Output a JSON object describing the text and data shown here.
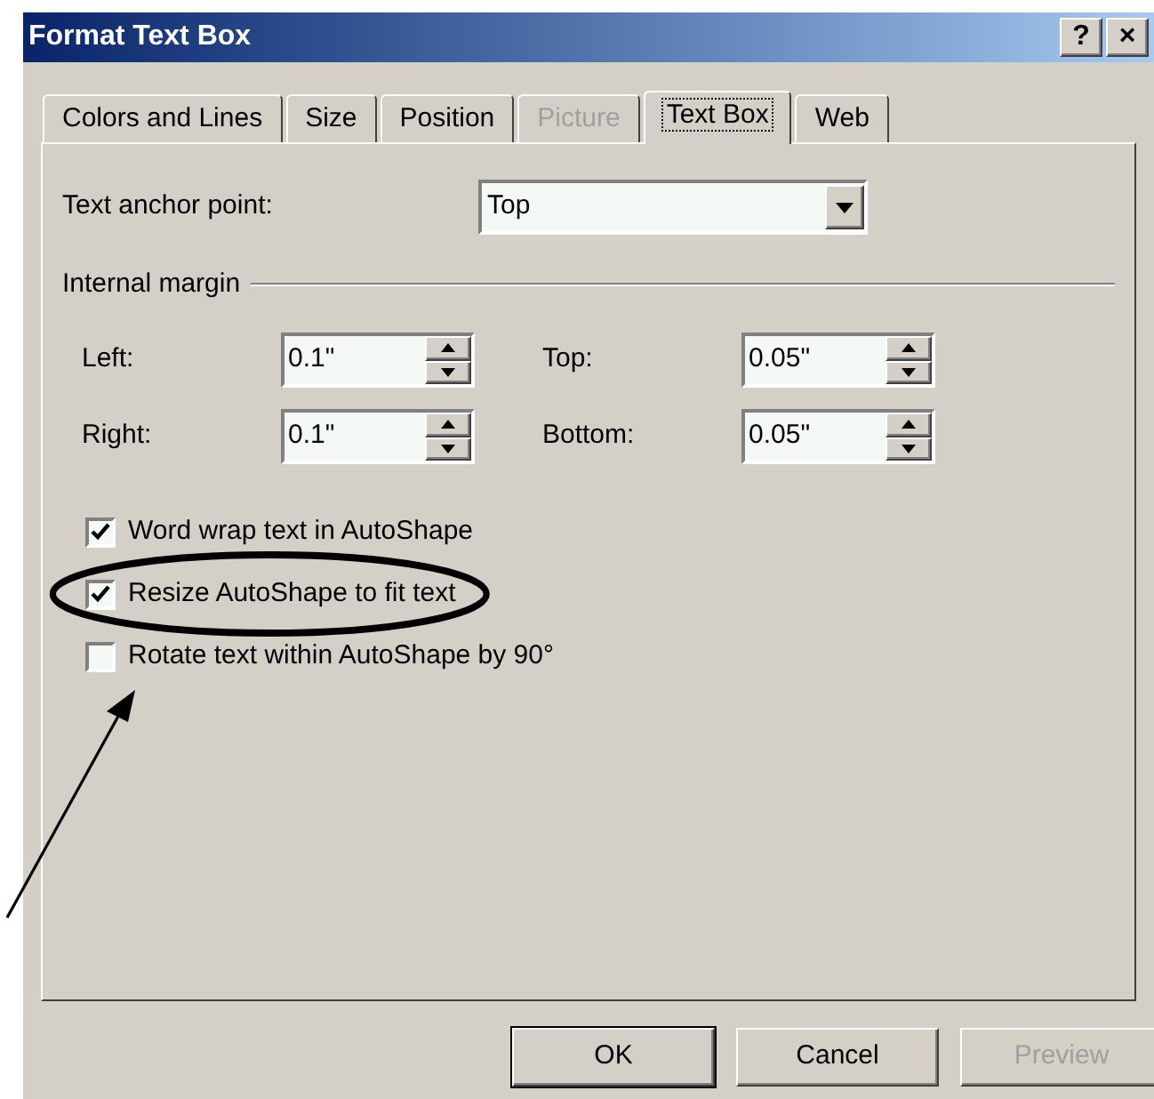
{
  "window": {
    "title": "Format Text Box",
    "title_buttons": [
      "?",
      "×"
    ]
  },
  "tabs": [
    {
      "label": "Colors and Lines",
      "selected": false,
      "disabled": false
    },
    {
      "label": "Size",
      "selected": false,
      "disabled": false
    },
    {
      "label": "Position",
      "selected": false,
      "disabled": false
    },
    {
      "label": "Picture",
      "selected": false,
      "disabled": true
    },
    {
      "label": "Text Box",
      "selected": true,
      "disabled": false
    },
    {
      "label": "Web",
      "selected": false,
      "disabled": false
    }
  ],
  "anchor": {
    "label": "Text anchor point:",
    "value": "Top"
  },
  "internal_margin": {
    "title": "Internal margin",
    "fields": [
      {
        "label": "Left:",
        "value": "0.1\""
      },
      {
        "label": "Top:",
        "value": "0.05\""
      },
      {
        "label": "Right:",
        "value": "0.1\""
      },
      {
        "label": "Bottom:",
        "value": "0.05\""
      }
    ]
  },
  "checkboxes": [
    {
      "label": "Word wrap text in AutoShape",
      "checked": true,
      "circled": false
    },
    {
      "label": "Resize AutoShape to fit text",
      "checked": true,
      "circled": true
    },
    {
      "label": "Rotate text within AutoShape by 90°",
      "checked": false,
      "circled": false
    }
  ],
  "buttons": [
    {
      "label": "OK",
      "disabled": false,
      "default": true
    },
    {
      "label": "Cancel",
      "disabled": false,
      "default": false
    },
    {
      "label": "Preview",
      "disabled": true,
      "default": false
    }
  ]
}
